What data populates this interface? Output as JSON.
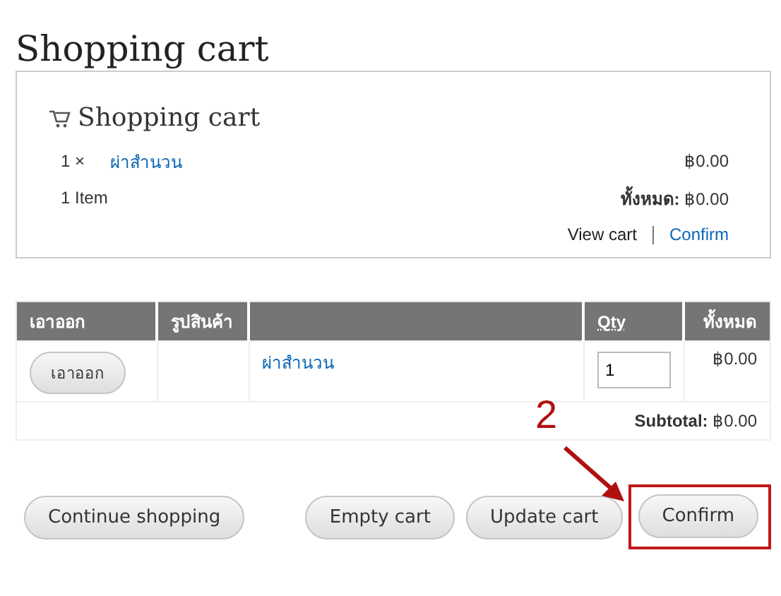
{
  "page_title": "Shopping cart",
  "block": {
    "title": "Shopping cart",
    "items": [
      {
        "qty": "1 ×",
        "name": "ผ่าสำนวน",
        "price": "฿0.00"
      }
    ],
    "count": "1 Item",
    "total_label": "ทั้งหมด:",
    "total": "฿0.00",
    "links": [
      "View cart",
      "Confirm"
    ]
  },
  "table": {
    "columns": [
      {
        "label": "เอาออก",
        "kind": "text"
      },
      {
        "label": "รูปสินค้า",
        "kind": "text"
      },
      {
        "kind": "blank"
      },
      {
        "label": "Qty",
        "kind": "link"
      },
      {
        "label": "ทั้งหมด",
        "kind": "text"
      }
    ],
    "rows": [
      {
        "remove": "เอาออก",
        "name": "ผ่าสำนวน",
        "qty": "1",
        "total": "฿0.00"
      }
    ],
    "subtotal_label": "Subtotal:",
    "subtotal": "฿0.00"
  },
  "buttons": [
    {
      "label": "Continue shopping",
      "highlighted": false
    },
    {
      "label": "Empty cart",
      "highlighted": false
    },
    {
      "label": "Update cart",
      "highlighted": false
    },
    {
      "label": "Confirm",
      "highlighted": true
    }
  ],
  "annotation": {
    "step": "2"
  }
}
